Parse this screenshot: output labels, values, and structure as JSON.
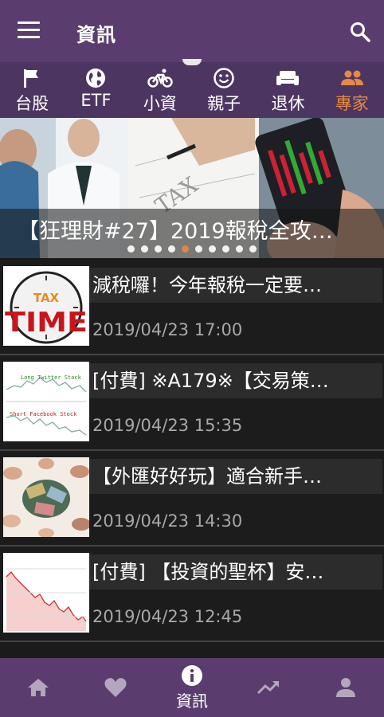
{
  "header": {
    "title": "資訊"
  },
  "categories": [
    {
      "label": "台股",
      "icon": "flag-icon"
    },
    {
      "label": "ETF",
      "icon": "globe-icon"
    },
    {
      "label": "小資",
      "icon": "bike-icon"
    },
    {
      "label": "親子",
      "icon": "smile-icon"
    },
    {
      "label": "退休",
      "icon": "sofa-icon"
    },
    {
      "label": "專家",
      "icon": "people-icon",
      "active": true
    }
  ],
  "banner": {
    "title": "【狂理財#27】2019報稅全攻…",
    "page_count": 10,
    "active_index": 4
  },
  "articles": [
    {
      "title": "減稅囉！今年報稅一定要…",
      "date": "2019/04/23 17:00",
      "thumb": "tax-time",
      "thumb_text": [
        "TAX",
        "TIME"
      ]
    },
    {
      "title": "[付費] ※A179※【交易策…",
      "date": "2019/04/23 15:35",
      "thumb": "stock-chart",
      "thumb_text": [
        "Long Twitter Stock",
        "Short Facebook Stock"
      ]
    },
    {
      "title": "【外匯好好玩】適合新手…",
      "date": "2019/04/23 14:30",
      "thumb": "currency-hands",
      "thumb_text": []
    },
    {
      "title": "[付費] 【投資的聖杯】安…",
      "date": "2019/04/23 12:45",
      "thumb": "price-chart",
      "thumb_text": []
    }
  ],
  "bottom_nav": [
    {
      "icon": "home-icon",
      "label": ""
    },
    {
      "icon": "heart-icon",
      "label": ""
    },
    {
      "icon": "info-icon",
      "label": "資訊",
      "active": true
    },
    {
      "icon": "trending-icon",
      "label": ""
    },
    {
      "icon": "person-icon",
      "label": ""
    }
  ],
  "colors": {
    "primary": "#5a3d6e",
    "category_bar": "#4d3561",
    "accent": "#e58a45",
    "list_bg": "#1c1c1c",
    "date": "#a8a8a8"
  }
}
